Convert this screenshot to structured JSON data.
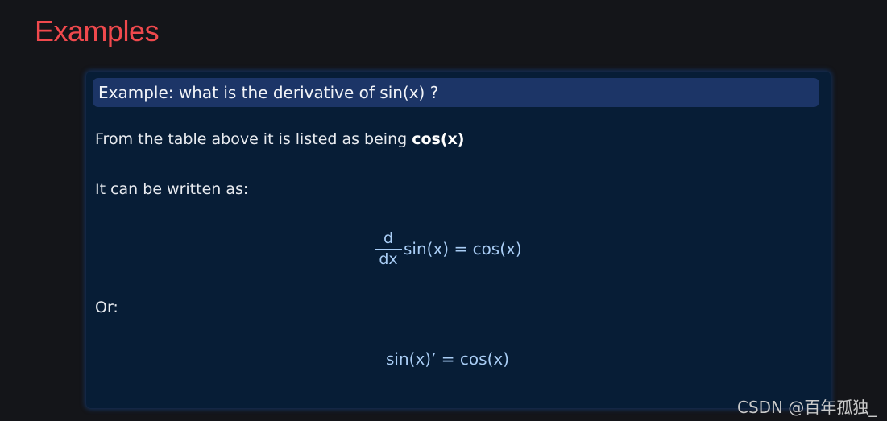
{
  "heading": "Examples",
  "example": {
    "title": "Example: what is the derivative of sin(x) ?",
    "line1_prefix": "From the table above it is listed as being ",
    "line1_bold": "cos(x)",
    "line2": "It can be written as:",
    "formula1": {
      "numerator": "d",
      "denominator": "dx",
      "expression": "sin(x) = cos(x)"
    },
    "line3": "Or:",
    "formula2": "sin(x)’ = cos(x)"
  },
  "watermark": "CSDN @百年孤独_",
  "colors": {
    "background": "#141519",
    "heading": "#f0494d",
    "box": "#071d36",
    "title_bar": "#1c3567",
    "math": "#a9cdf5"
  }
}
